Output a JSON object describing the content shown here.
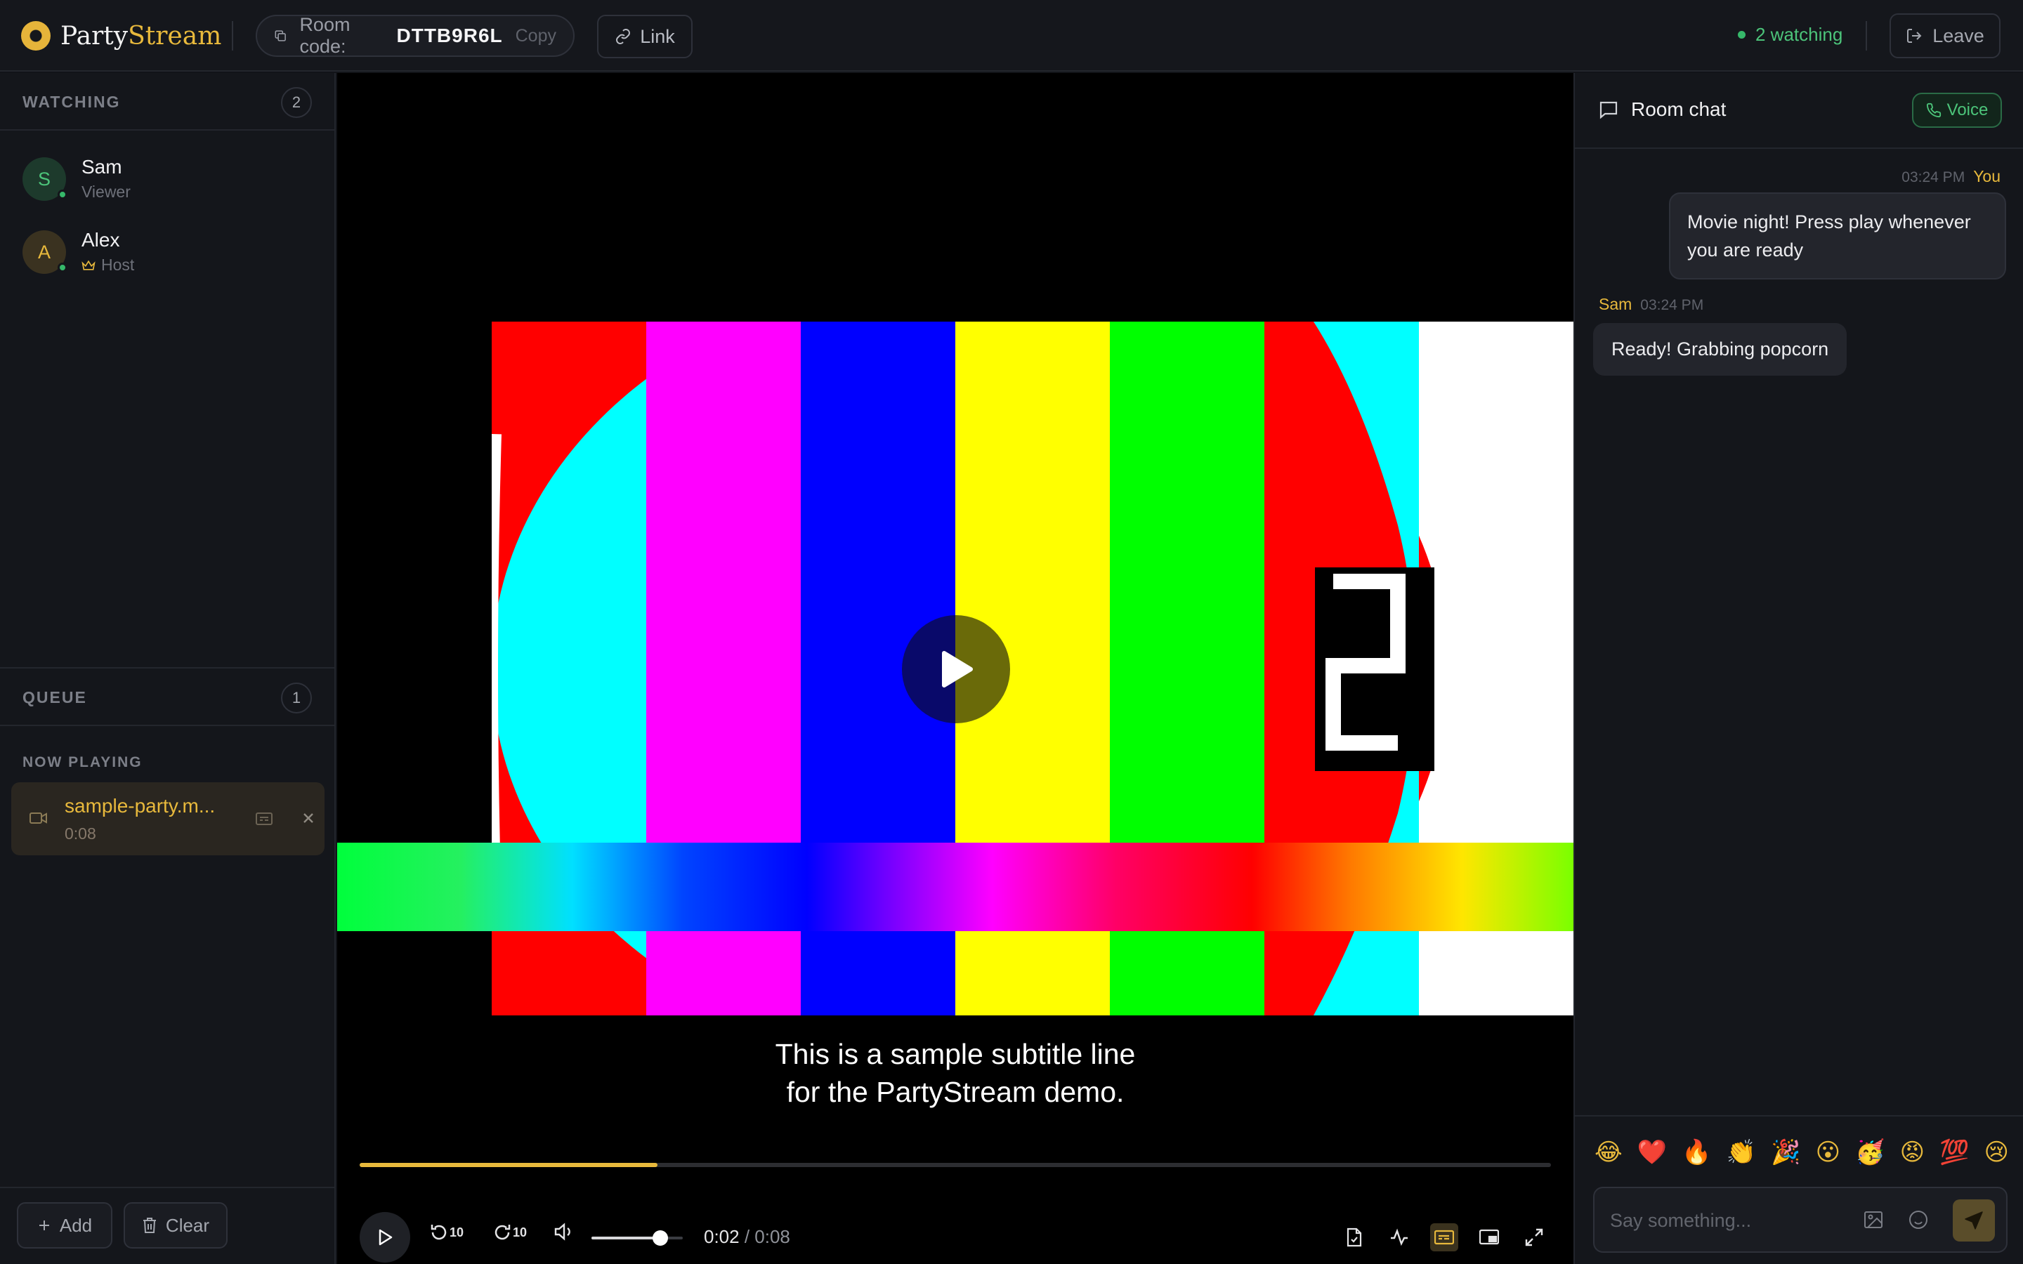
{
  "app": {
    "brand_first": "Party",
    "brand_second": "Stream",
    "room_label": "Room code:",
    "room_code": "DTTB9R6L",
    "copy_label": "Copy",
    "link_label": "Link",
    "watching_label": "2 watching",
    "leave_label": "Leave"
  },
  "sidebar": {
    "watching_title": "WATCHING",
    "watching_count": "2",
    "users": [
      {
        "initial": "S",
        "name": "Sam",
        "role": "Viewer",
        "avatar_bg": "#1d3a2c",
        "avatar_fg": "#4cc47a"
      },
      {
        "initial": "A",
        "name": "Alex",
        "role": "Host",
        "avatar_bg": "#3a3220",
        "avatar_fg": "#e8b93c"
      }
    ],
    "queue_title": "QUEUE",
    "queue_count": "1",
    "now_playing_label": "NOW PLAYING",
    "now_playing": {
      "name": "sample-party.m...",
      "duration": "0:08"
    },
    "add_label": "Add",
    "clear_label": "Clear"
  },
  "player": {
    "subtitle_line1": "This is a sample subtitle line",
    "subtitle_line2": "for the PartyStream demo.",
    "current_time": "0:02",
    "duration": "/ 0:08",
    "progress_fraction": 0.25,
    "volume_fraction": 0.75,
    "skip_back_label": "10",
    "skip_forward_label": "10"
  },
  "chat": {
    "title": "Room chat",
    "voice_label": "Voice",
    "messages": [
      {
        "author": "You",
        "time": "03:24 PM",
        "text": "Movie night! Press play whenever you are ready"
      },
      {
        "author": "Sam",
        "time": "03:24 PM",
        "text": "Ready! Grabbing popcorn"
      }
    ],
    "emojis": [
      "😂",
      "❤️",
      "🔥",
      "👏",
      "🎉",
      "😮",
      "🥳",
      "😡",
      "💯",
      "😢"
    ],
    "input_placeholder": "Say something..."
  },
  "colors": {
    "accent": "#e8b93c",
    "online": "#36b86a",
    "background": "#111318"
  }
}
